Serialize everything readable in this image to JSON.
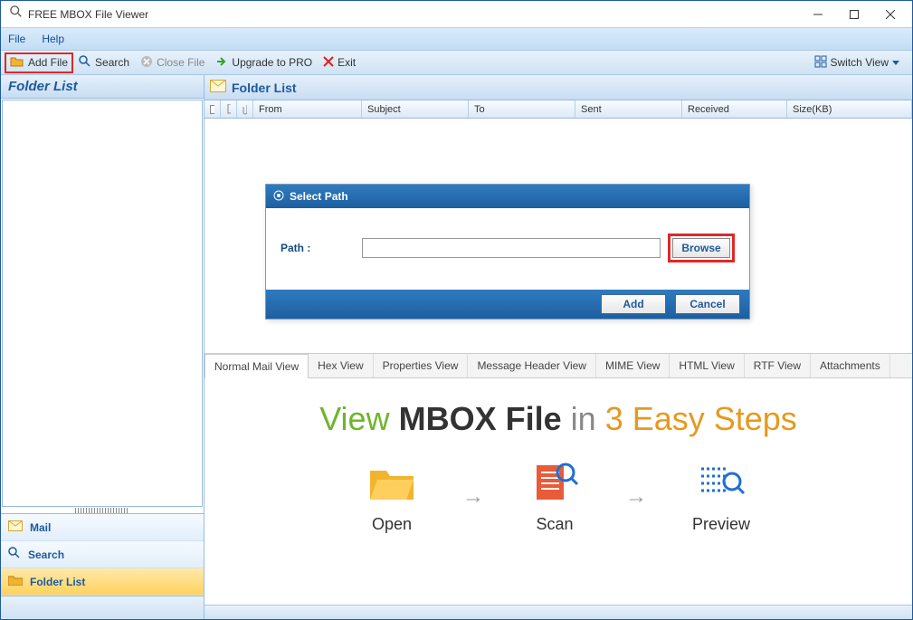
{
  "window": {
    "title": "FREE MBOX File Viewer"
  },
  "menu": {
    "file": "File",
    "help": "Help"
  },
  "toolbar": {
    "add_file": "Add File",
    "search": "Search",
    "close_file": "Close File",
    "upgrade": "Upgrade to PRO",
    "exit": "Exit",
    "switch_view": "Switch View"
  },
  "sidebar": {
    "header": "Folder List",
    "nav": {
      "mail": "Mail",
      "search": "Search",
      "folder_list": "Folder List"
    }
  },
  "content": {
    "header": "Folder List",
    "columns": {
      "from": "From",
      "subject": "Subject",
      "to": "To",
      "sent": "Sent",
      "received": "Received",
      "size": "Size(KB)"
    }
  },
  "dialog": {
    "title": "Select Path",
    "path_label": "Path :",
    "path_value": "",
    "browse": "Browse",
    "add": "Add",
    "cancel": "Cancel"
  },
  "tabs": {
    "normal": "Normal Mail View",
    "hex": "Hex View",
    "properties": "Properties View",
    "header": "Message Header View",
    "mime": "MIME View",
    "html": "HTML View",
    "rtf": "RTF View",
    "attachments": "Attachments"
  },
  "promo": {
    "w1": "View",
    "w2": "MBOX File",
    "w3": "in",
    "w4": "3 Easy Steps",
    "step1": "Open",
    "step2": "Scan",
    "step3": "Preview"
  }
}
